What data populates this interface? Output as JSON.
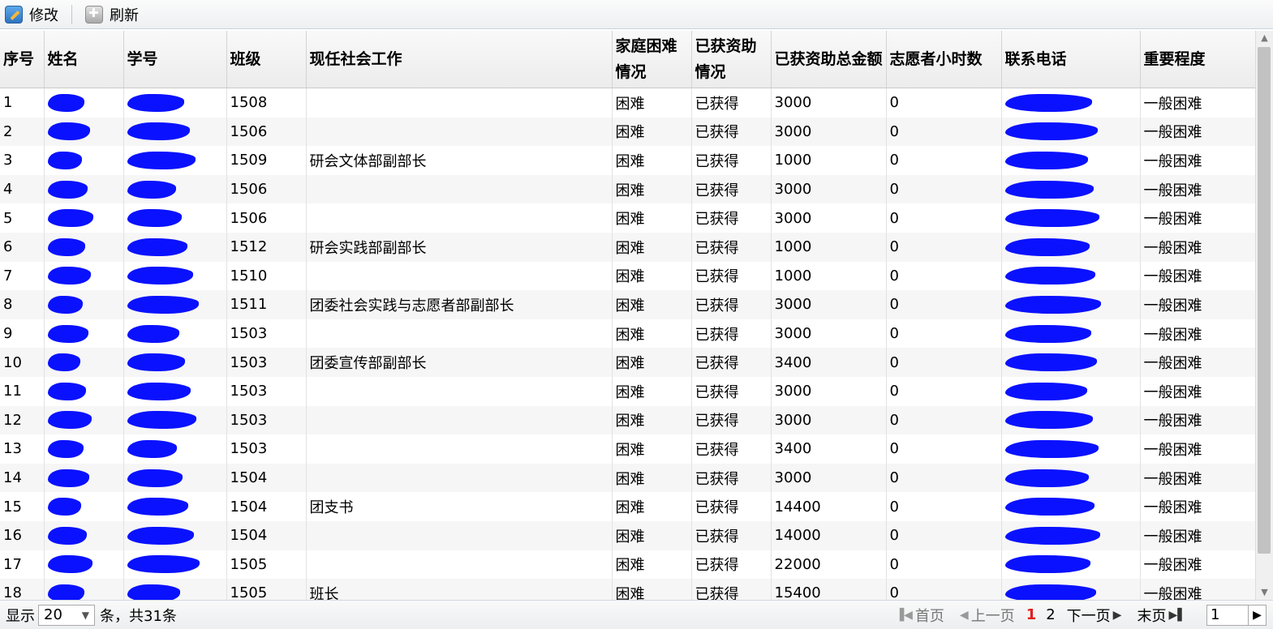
{
  "toolbar": {
    "edit_label": "修改",
    "refresh_label": "刷新"
  },
  "table": {
    "headers": [
      "序号",
      "姓名",
      "学号",
      "班级",
      "现任社会工作",
      "家庭困难情况",
      "已获资助情况",
      "已获资助总金额",
      "志愿者小时数",
      "联系电话",
      "重要程度"
    ],
    "rows": [
      [
        "1",
        "",
        "",
        "1508",
        "",
        "困难",
        "已获得",
        "3000",
        "0",
        "",
        "一般困难"
      ],
      [
        "2",
        "",
        "",
        "1506",
        "",
        "困难",
        "已获得",
        "3000",
        "0",
        "",
        "一般困难"
      ],
      [
        "3",
        "",
        "",
        "1509",
        "研会文体部副部长",
        "困难",
        "已获得",
        "1000",
        "0",
        "",
        "一般困难"
      ],
      [
        "4",
        "",
        "",
        "1506",
        "",
        "困难",
        "已获得",
        "3000",
        "0",
        "",
        "一般困难"
      ],
      [
        "5",
        "",
        "",
        "1506",
        "",
        "困难",
        "已获得",
        "3000",
        "0",
        "",
        "一般困难"
      ],
      [
        "6",
        "",
        "",
        "1512",
        "研会实践部副部长",
        "困难",
        "已获得",
        "1000",
        "0",
        "",
        "一般困难"
      ],
      [
        "7",
        "",
        "",
        "1510",
        "",
        "困难",
        "已获得",
        "1000",
        "0",
        "",
        "一般困难"
      ],
      [
        "8",
        "",
        "",
        "1511",
        "团委社会实践与志愿者部副部长",
        "困难",
        "已获得",
        "3000",
        "0",
        "",
        "一般困难"
      ],
      [
        "9",
        "",
        "",
        "1503",
        "",
        "困难",
        "已获得",
        "3000",
        "0",
        "",
        "一般困难"
      ],
      [
        "10",
        "",
        "",
        "1503",
        "团委宣传部副部长",
        "困难",
        "已获得",
        "3400",
        "0",
        "",
        "一般困难"
      ],
      [
        "11",
        "",
        "",
        "1503",
        "",
        "困难",
        "已获得",
        "3000",
        "0",
        "",
        "一般困难"
      ],
      [
        "12",
        "",
        "",
        "1503",
        "",
        "困难",
        "已获得",
        "3000",
        "0",
        "",
        "一般困难"
      ],
      [
        "13",
        "",
        "",
        "1503",
        "",
        "困难",
        "已获得",
        "3400",
        "0",
        "",
        "一般困难"
      ],
      [
        "14",
        "",
        "",
        "1504",
        "",
        "困难",
        "已获得",
        "3000",
        "0",
        "",
        "一般困难"
      ],
      [
        "15",
        "",
        "",
        "1504",
        "团支书",
        "困难",
        "已获得",
        "14400",
        "0",
        "",
        "一般困难"
      ],
      [
        "16",
        "",
        "",
        "1504",
        "",
        "困难",
        "已获得",
        "14000",
        "0",
        "",
        "一般困难"
      ],
      [
        "17",
        "",
        "",
        "1505",
        "",
        "困难",
        "已获得",
        "22000",
        "0",
        "",
        "一般困难"
      ],
      [
        "18",
        "",
        "",
        "1505",
        "班长",
        "困难",
        "已获得",
        "15400",
        "0",
        "",
        "一般困难"
      ]
    ]
  },
  "pager": {
    "show_label": "显示",
    "page_size": "20",
    "total_label": "条，共31条",
    "first": "首页",
    "prev": "上一页",
    "pages": [
      "1",
      "2"
    ],
    "current_page": "1",
    "next": "下一页",
    "last": "末页",
    "goto_value": "1"
  },
  "colors": {
    "redaction": "#0a11ff",
    "current_page": "#e02020"
  }
}
